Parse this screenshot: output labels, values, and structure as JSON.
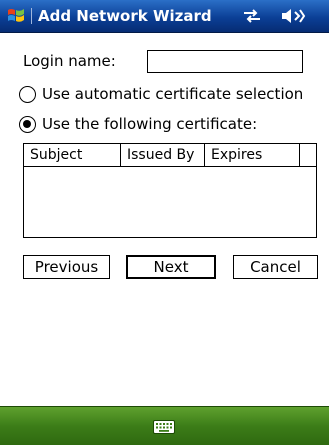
{
  "titlebar": {
    "title": "Add Network Wizard",
    "icons": [
      "windows-logo-icon",
      "connectivity-icon",
      "volume-icon"
    ]
  },
  "form": {
    "login_label": "Login name:",
    "login_value": "",
    "radio_auto_label": "Use automatic certificate selection",
    "radio_following_label": "Use the following certificate:",
    "selected_option": "Use the following certificate:"
  },
  "cert_table": {
    "columns": [
      "Subject",
      "Issued By",
      "Expires",
      ""
    ],
    "rows": []
  },
  "buttons": {
    "previous": "Previous",
    "next": "Next",
    "cancel": "Cancel"
  },
  "bottombar": {
    "icons": [
      "keyboard-icon"
    ]
  },
  "colors": {
    "titlebar": "#0b3f96",
    "bottombar": "#3c7d18",
    "background": "#ffffff"
  }
}
